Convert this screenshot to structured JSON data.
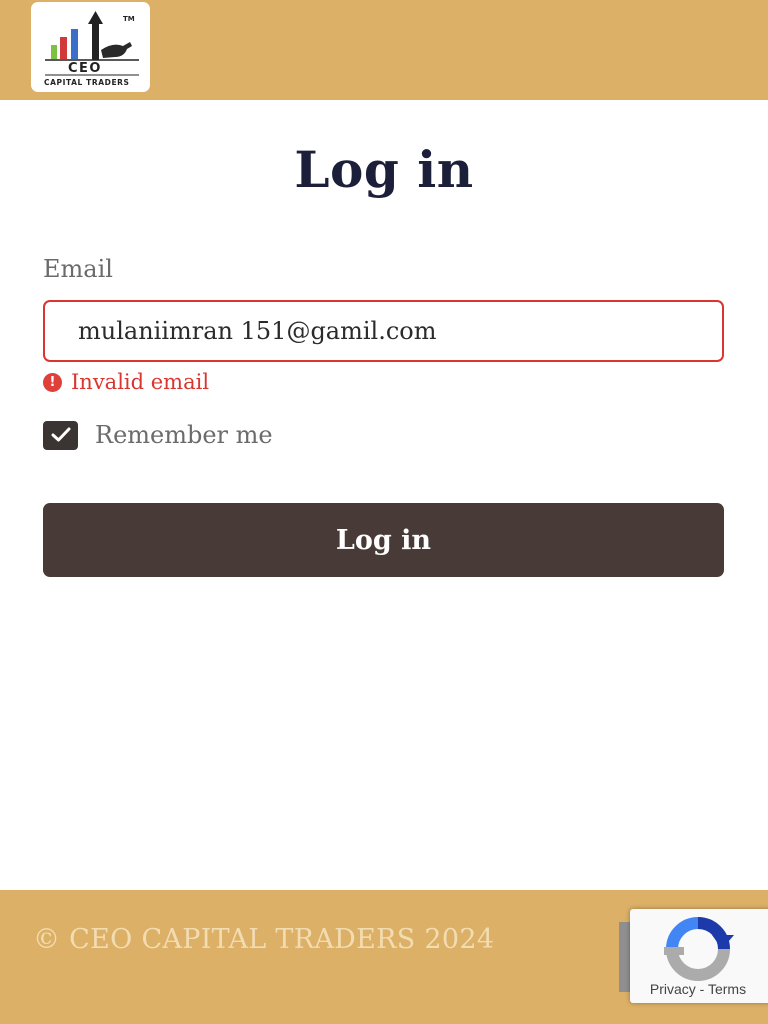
{
  "brand": {
    "logo_text": "CEO",
    "logo_subtext": "CAPITAL TRADERS",
    "trademark": "TM"
  },
  "page": {
    "title": "Log in"
  },
  "form": {
    "email_label": "Email",
    "email_value": "mulaniimran 151@gamil.com",
    "error_message": "Invalid email",
    "remember_label": "Remember me",
    "remember_checked": true,
    "submit_label": "Log in"
  },
  "footer": {
    "copyright": "© CEO CAPITAL TRADERS 2024"
  },
  "recaptcha": {
    "privacy_label": "Privacy",
    "separator": " - ",
    "terms_label": "Terms"
  },
  "colors": {
    "header_bg": "#dcb066",
    "title": "#1c1f3a",
    "error": "#d9362f",
    "button_bg": "#473a37"
  }
}
